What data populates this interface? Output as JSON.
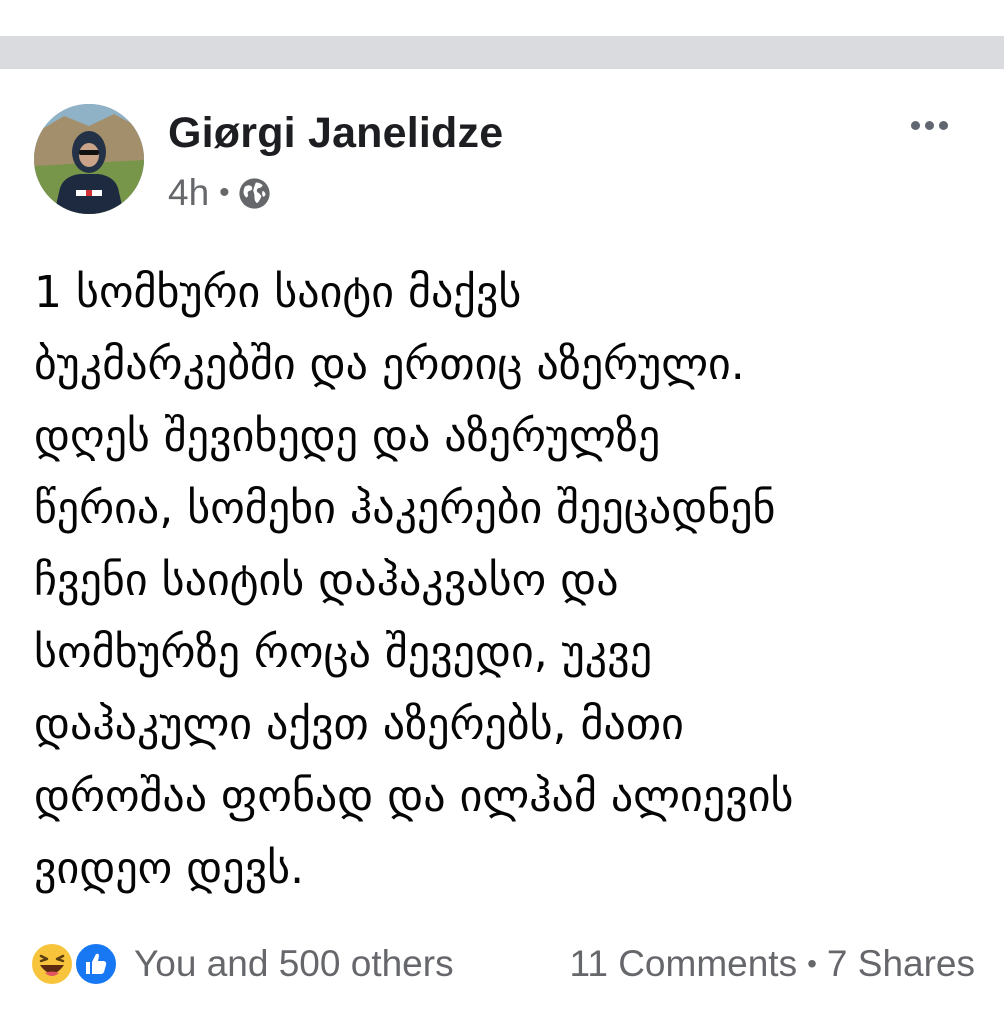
{
  "post": {
    "author": "Giørgi Janelidze",
    "timestamp": "4h",
    "separator": "•",
    "visibility_icon": "globe-icon",
    "menu_icon": "more-options-icon",
    "body_lines": [
      "1 სომხური საიტი მაქვს",
      "ბუკმარკებში და ერთიც აზერული.",
      "დღეს შევიხედე და აზერულზე",
      "წერია, სომეხი ჰაკერები შეეცადნენ",
      "ჩვენი საიტის დაჰაკვასო და",
      "სომხურზე როცა შევედი, უკვე",
      "დაჰაკული აქვთ აზერებს, მათი",
      "დროშაა ფონად და ილჰამ ალიევის",
      "ვიდეო დევს."
    ]
  },
  "footer": {
    "reactions": [
      "haha-icon",
      "like-icon"
    ],
    "reaction_text": "You and 500 others",
    "comments": "11 Comments",
    "separator": "•",
    "shares": "7 Shares"
  },
  "colors": {
    "divider_band": "#d9dbdf",
    "secondary_text": "#65676b",
    "primary_text": "#050505",
    "like_blue": "#1877f2",
    "haha_yellow": "#f7c43b"
  }
}
